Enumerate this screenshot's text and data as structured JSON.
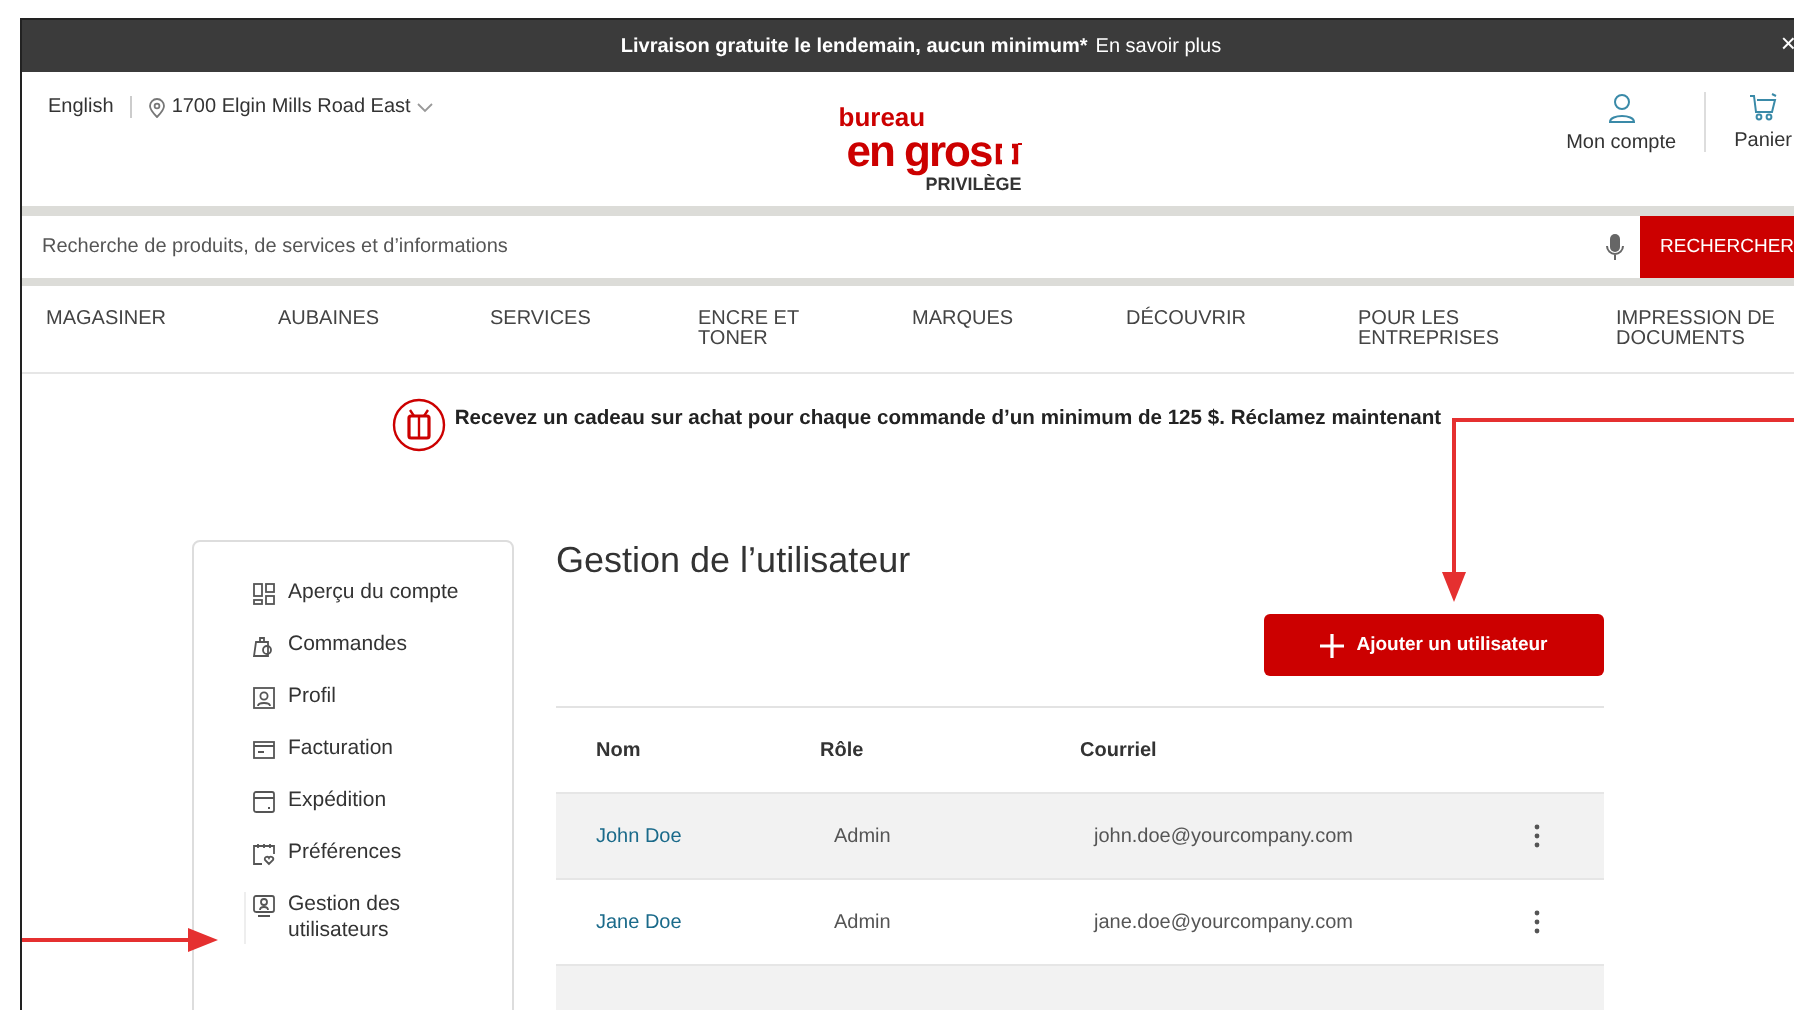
{
  "banner": {
    "text": "Livraison gratuite le lendemain, aucun minimum*",
    "link": "En savoir plus",
    "close": "×"
  },
  "header": {
    "language": "English",
    "location": "1700 Elgin Mills Road East",
    "logo": {
      "top": "bureau",
      "main": "en gros",
      "sub": "PRIVILÈGE"
    },
    "account": "Mon compte",
    "cart": "Panier"
  },
  "search": {
    "placeholder": "Recherche de produits, de services et d’informations",
    "button": "RECHERCHER"
  },
  "nav": [
    "MAGASINER",
    "AUBAINES",
    "SERVICES",
    "ENCRE ET TONER",
    "MARQUES",
    "DÉCOUVRIR",
    "POUR LES ENTREPRISES",
    "IMPRESSION DE DOCUMENTS"
  ],
  "promo": "Recevez un cadeau sur achat pour chaque commande d’un minimum de 125 $. Réclamez maintenant",
  "sidebar": {
    "items": [
      {
        "label": "Aperçu du compte",
        "selected": false
      },
      {
        "label": "Commandes",
        "selected": false
      },
      {
        "label": "Profil",
        "selected": false
      },
      {
        "label": "Facturation",
        "selected": false
      },
      {
        "label": "Expédition",
        "selected": false
      },
      {
        "label": "Préférences",
        "selected": false
      },
      {
        "label": "Gestion des utilisateurs",
        "selected": true
      }
    ]
  },
  "page": {
    "title": "Gestion de l’utilisateur",
    "add_button": "Ajouter un utilisateur"
  },
  "table": {
    "columns": [
      "Nom",
      "Rôle",
      "Courriel"
    ],
    "rows": [
      {
        "name": "John Doe",
        "role": "Admin",
        "email": "john.doe@yourcompany.com"
      },
      {
        "name": "Jane Doe",
        "role": "Admin",
        "email": "jane.doe@yourcompany.com"
      }
    ]
  }
}
